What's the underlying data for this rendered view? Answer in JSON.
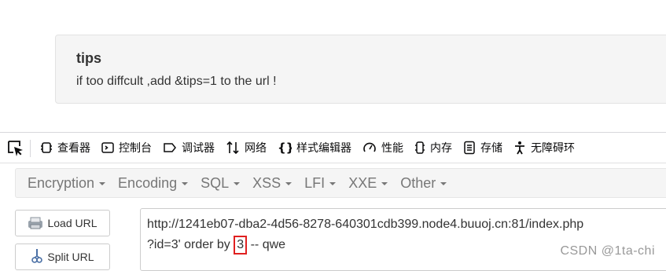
{
  "tips": {
    "title": "tips",
    "text": "if too diffcult ,add &tips=1 to the url !"
  },
  "devtools": {
    "tabs": [
      {
        "label": "查看器",
        "icon": "inspector-icon"
      },
      {
        "label": "控制台",
        "icon": "console-icon"
      },
      {
        "label": "调试器",
        "icon": "debugger-icon"
      },
      {
        "label": "网络",
        "icon": "network-icon"
      },
      {
        "label": "样式编辑器",
        "icon": "style-editor-icon"
      },
      {
        "label": "性能",
        "icon": "performance-icon"
      },
      {
        "label": "内存",
        "icon": "memory-icon"
      },
      {
        "label": "存储",
        "icon": "storage-icon"
      },
      {
        "label": "无障碍环",
        "icon": "accessibility-icon"
      }
    ]
  },
  "hackbar": {
    "menu": [
      "Encryption",
      "Encoding",
      "SQL",
      "XSS",
      "LFI",
      "XXE",
      "Other"
    ],
    "load_url": "Load URL",
    "split_url": "Split URL",
    "url_line1": "http://1241eb07-dba2-4d56-8278-640301cdb399.node4.buuoj.cn:81/index.php",
    "url_line2_before": "?id=3' order by ",
    "url_line2_highlight": "3",
    "url_line2_after": " -- qwe"
  },
  "watermark": "CSDN @1ta-chi"
}
